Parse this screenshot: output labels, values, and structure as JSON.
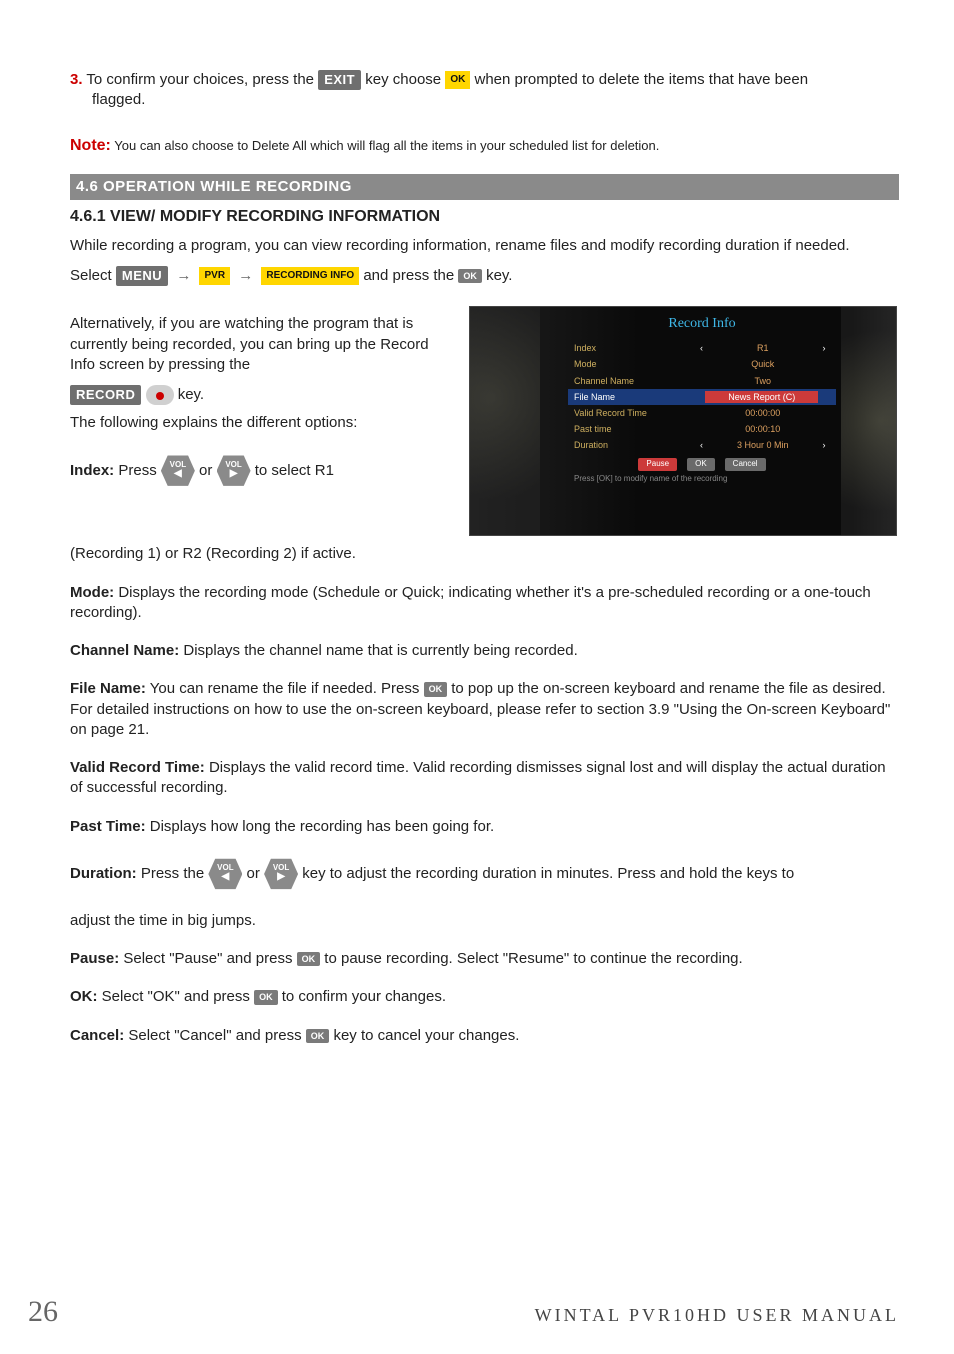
{
  "step3": {
    "num": "3.",
    "before_exit": " To confirm your choices, press the ",
    "exit_key": "EXIT",
    "between": " key choose ",
    "ok_key": "OK",
    "after": " when prompted to delete the items that have been",
    "line2": "flagged."
  },
  "note": {
    "label": "Note:",
    "text": " You can also choose to Delete All which will flag all the items in your scheduled list for deletion."
  },
  "section_bar": "4.6 OPERATION WHILE RECORDING",
  "sub_heading": "4.6.1 VIEW/ MODIFY RECORDING INFORMATION",
  "intro": "While recording a program, you can view recording information, rename files and modify recording duration if needed.",
  "select_line": {
    "select": "Select ",
    "menu": "MENU",
    "pvr": "PVR",
    "recinfo": "RECORDING INFO",
    "mid": " and press the ",
    "ok": "OK",
    "end": " key."
  },
  "alt_para": "Alternatively, if you are watching the program that is currently being recorded, you can bring up the Record Info screen by pressing the",
  "record_key": "RECORD",
  "record_key_tail": " key.",
  "following": "The following explains the different options:",
  "index": {
    "label": "Index:",
    "before": " Press ",
    "or": " or ",
    "after": " to select R1",
    "vol": "VOL"
  },
  "index_tail": "(Recording 1) or R2 (Recording 2) if active.",
  "mode": {
    "label": "Mode:",
    "text": " Displays the recording mode (Schedule or Quick; indicating whether it's a pre-scheduled recording or a one-touch recording)."
  },
  "channel": {
    "label": "Channel Name:",
    "text": " Displays the channel name that is currently being recorded."
  },
  "filename": {
    "label": "File Name:",
    "before": " You can rename the file if needed. Press ",
    "ok": "OK",
    "after": " to pop up the on-screen keyboard and rename the file as desired. For detailed instructions on how to use the on-screen keyboard, please refer to section 3.9 \"Using the On-screen Keyboard\" on page 21."
  },
  "valid": {
    "label": "Valid Record Time:",
    "text": " Displays the valid record time. Valid recording dismisses signal lost and will display the actual  duration of successful recording."
  },
  "past": {
    "label": "Past Time:",
    "text": " Displays how long the recording has been going for."
  },
  "duration": {
    "label": "Duration:",
    "before": " Press the ",
    "or": " or ",
    "after": " key to adjust the recording duration in minutes. Press and hold the keys to",
    "tail": "adjust the time in big jumps.",
    "vol": "VOL"
  },
  "pause": {
    "label": "Pause:",
    "before": " Select \"Pause\" and press ",
    "ok": "OK",
    "after": " to pause recording. Select \"Resume\" to continue the recording."
  },
  "okrow": {
    "label": "OK:",
    "before": " Select \"OK\" and press ",
    "ok": "OK",
    "after": " to confirm your changes."
  },
  "cancel": {
    "label": "Cancel:",
    "before": " Select \"Cancel\" and press ",
    "ok": "OK",
    "after": " key to cancel your changes."
  },
  "footer": {
    "page": "26",
    "title": "WINTAL PVR10HD USER MANUAL"
  },
  "tv": {
    "title": "Record Info",
    "rows": {
      "index": {
        "l": "Index",
        "r": "R1"
      },
      "mode": {
        "l": "Mode",
        "r": "Quick"
      },
      "channel": {
        "l": "Channel Name",
        "r": "Two"
      },
      "file": {
        "l": "File Name",
        "r": "News Report (C)"
      },
      "valid": {
        "l": "Valid Record Time",
        "r": "00:00:00"
      },
      "past": {
        "l": "Past time",
        "r": "00:00:10"
      },
      "dur": {
        "l": "Duration",
        "r": "3 Hour  0 Min"
      }
    },
    "btns": {
      "pause": "Pause",
      "ok": "OK",
      "cancel": "Cancel"
    },
    "hint": "Press [OK] to modify name of the recording"
  }
}
